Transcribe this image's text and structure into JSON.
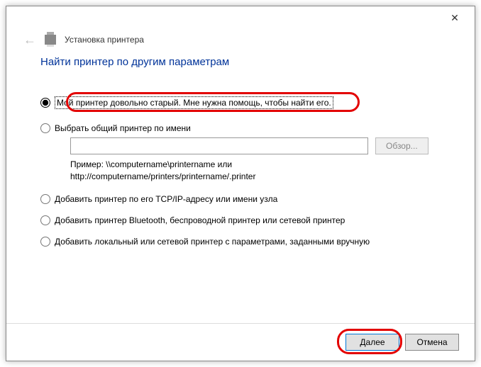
{
  "titlebar": {
    "close": "✕"
  },
  "header": {
    "back_arrow": "←",
    "wizard_title": "Установка принтера"
  },
  "heading": "Найти принтер по другим параметрам",
  "options": {
    "old_printer": "Мой принтер довольно старый. Мне нужна помощь, чтобы найти его.",
    "shared_by_name": "Выбрать общий принтер по имени",
    "browse_label": "Обзор...",
    "example_line1": "Пример: \\\\computername\\printername или",
    "example_line2": "http://computername/printers/printername/.printer",
    "tcpip": "Добавить принтер по его TCP/IP-адресу или имени узла",
    "bluetooth": "Добавить принтер Bluetooth, беспроводной принтер или сетевой принтер",
    "local": "Добавить локальный или сетевой принтер с параметрами, заданными вручную"
  },
  "footer": {
    "next": "Далее",
    "cancel": "Отмена"
  }
}
